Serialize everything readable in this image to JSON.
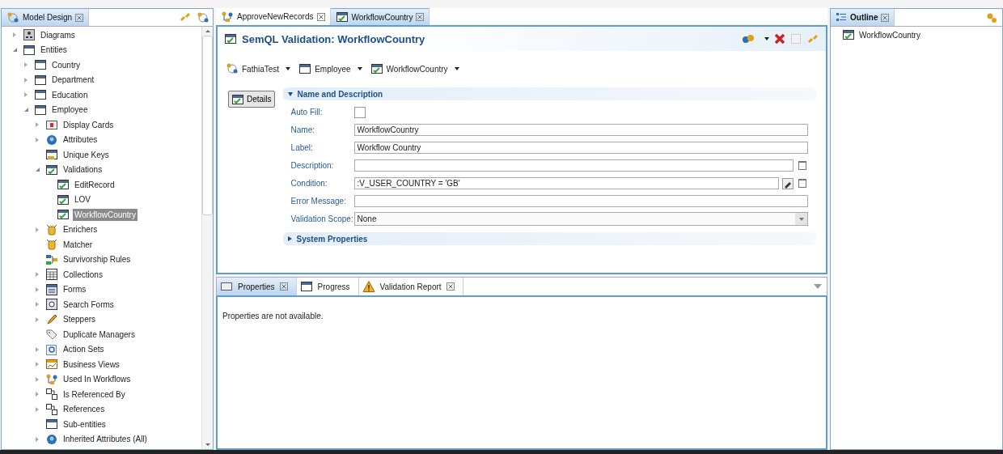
{
  "model_design": {
    "title": "Model Design",
    "tree": [
      {
        "label": "Diagrams",
        "kind": "diagram",
        "expanded": false,
        "selected": false
      },
      {
        "label": "Entities",
        "kind": "entity",
        "expanded": true,
        "selected": false,
        "children": [
          {
            "label": "Country",
            "kind": "entity",
            "expanded": false,
            "selected": false
          },
          {
            "label": "Department",
            "kind": "entity",
            "expanded": false,
            "selected": false
          },
          {
            "label": "Education",
            "kind": "entity",
            "expanded": false,
            "selected": false
          },
          {
            "label": "Employee",
            "kind": "entity",
            "expanded": true,
            "selected": false,
            "children": [
              {
                "label": "Display Cards",
                "kind": "cards",
                "expanded": false,
                "selected": false
              },
              {
                "label": "Attributes",
                "kind": "attributes",
                "expanded": false,
                "selected": false
              },
              {
                "label": "Unique Keys",
                "kind": "keys",
                "selected": false
              },
              {
                "label": "Validations",
                "kind": "validation",
                "expanded": true,
                "selected": false,
                "children": [
                  {
                    "label": "EditRecord",
                    "kind": "validation",
                    "selected": false
                  },
                  {
                    "label": "LOV",
                    "kind": "validation",
                    "selected": false
                  },
                  {
                    "label": "WorkflowCountry",
                    "kind": "validation",
                    "selected": true
                  }
                ]
              },
              {
                "label": "Enrichers",
                "kind": "enricher",
                "expanded": false,
                "selected": false
              },
              {
                "label": "Matcher",
                "kind": "enricher",
                "selected": false
              },
              {
                "label": "Survivorship Rules",
                "kind": "rules",
                "selected": false
              },
              {
                "label": "Collections",
                "kind": "collection",
                "expanded": false,
                "selected": false
              },
              {
                "label": "Forms",
                "kind": "form",
                "expanded": false,
                "selected": false
              },
              {
                "label": "Search Forms",
                "kind": "search-form",
                "expanded": false,
                "selected": false
              },
              {
                "label": "Steppers",
                "kind": "stepper",
                "expanded": false,
                "selected": false
              },
              {
                "label": "Duplicate Managers",
                "kind": "duplicates",
                "selected": false
              },
              {
                "label": "Action Sets",
                "kind": "actions",
                "expanded": false,
                "selected": false
              },
              {
                "label": "Business Views",
                "kind": "views",
                "expanded": false,
                "selected": false
              },
              {
                "label": "Used In Workflows",
                "kind": "workflow",
                "expanded": false,
                "selected": false
              },
              {
                "label": "Is Referenced By",
                "kind": "references",
                "expanded": false,
                "selected": false
              },
              {
                "label": "References",
                "kind": "references",
                "expanded": false,
                "selected": false
              },
              {
                "label": "Sub-entities",
                "kind": "entity",
                "selected": false
              },
              {
                "label": "Inherited Attributes (All)",
                "kind": "attributes",
                "expanded": false,
                "selected": false
              }
            ]
          }
        ]
      }
    ]
  },
  "editor_tabs": [
    {
      "label": "ApproveNewRecords",
      "kind": "workflow",
      "selected": false
    },
    {
      "label": "WorkflowCountry",
      "kind": "validation",
      "selected": true
    }
  ],
  "editor": {
    "title": "SemQL Validation: WorkflowCountry",
    "breadcrumb": [
      {
        "label": "FathiaTest",
        "kind": "model"
      },
      {
        "label": "Employee",
        "kind": "entity"
      },
      {
        "label": "WorkflowCountry",
        "kind": "validation"
      }
    ],
    "side_buttons": [
      {
        "label": "Details",
        "selected": true
      }
    ],
    "sections": [
      {
        "title": "Name and Description",
        "expanded": true,
        "fields": [
          {
            "label": "Auto Fill:",
            "kind": "checkbox",
            "checked": false
          },
          {
            "label": "Name:",
            "kind": "text",
            "value": "WorkflowCountry"
          },
          {
            "label": "Label:",
            "kind": "text",
            "value": "Workflow Country"
          },
          {
            "label": "Description:",
            "kind": "text-editor"
          },
          {
            "label": "Condition:",
            "kind": "expression",
            "value": ":V_USER_COUNTRY = 'GB'"
          },
          {
            "label": "Error Message:",
            "kind": "text"
          },
          {
            "label": "Validation Scope:",
            "kind": "select",
            "value": "None"
          }
        ]
      },
      {
        "title": "System Properties",
        "expanded": false
      }
    ]
  },
  "bottom": {
    "tabs": [
      {
        "label": "Properties",
        "kind": "properties",
        "selected": true,
        "closable": true
      },
      {
        "label": "Progress",
        "kind": "progress",
        "selected": false,
        "closable": false
      },
      {
        "label": "Validation Report",
        "kind": "warning",
        "selected": false,
        "closable": true
      }
    ],
    "message": "Properties are not available."
  },
  "outline": {
    "title": "Outline",
    "items": [
      {
        "label": "WorkflowCountry",
        "kind": "validation"
      }
    ]
  }
}
